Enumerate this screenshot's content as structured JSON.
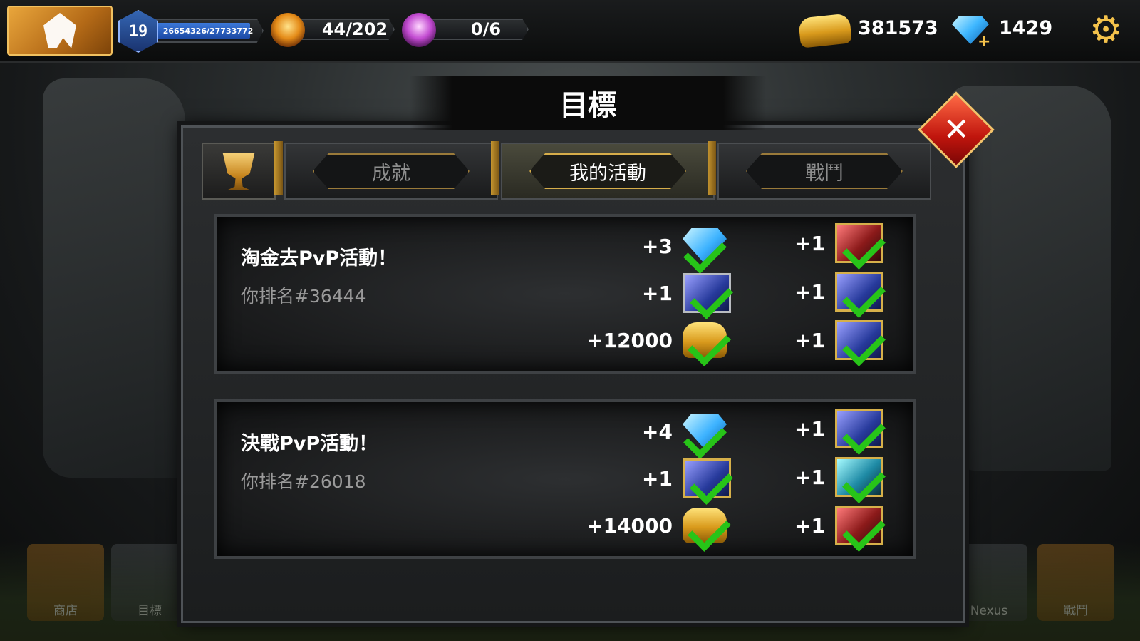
{
  "hud": {
    "level": "19",
    "xp_text": "26654326/27733772",
    "xp_progress": 0.96,
    "stamina": "44/202",
    "potions": "0/6",
    "gold": "381573",
    "gems": "1429"
  },
  "title": "目標",
  "tabs": [
    {
      "label": "成就",
      "active": false
    },
    {
      "label": "我的活動",
      "active": true
    },
    {
      "label": "戰鬥",
      "active": false
    }
  ],
  "events": [
    {
      "title": "淘金去PvP活動！",
      "rank": "你排名#36444",
      "rewards_main": [
        {
          "amount": "+3",
          "icon": "gem-icon"
        },
        {
          "amount": "+1",
          "icon": "hero-card-icon"
        },
        {
          "amount": "+12000",
          "icon": "gold-icon"
        }
      ],
      "rewards_side": [
        {
          "amount": "+1",
          "icon": "hero-card-icon"
        },
        {
          "amount": "+1",
          "icon": "hero-card-icon"
        },
        {
          "amount": "+1",
          "icon": "hero-card-icon"
        }
      ]
    },
    {
      "title": "決戰PvP活動！",
      "rank": "你排名#26018",
      "rewards_main": [
        {
          "amount": "+4",
          "icon": "gem-icon"
        },
        {
          "amount": "+1",
          "icon": "hero-card-icon"
        },
        {
          "amount": "+14000",
          "icon": "gold-icon"
        }
      ],
      "rewards_side": [
        {
          "amount": "+1",
          "icon": "hero-card-icon"
        },
        {
          "amount": "+1",
          "icon": "hero-card-icon"
        },
        {
          "amount": "+1",
          "icon": "hero-card-icon"
        }
      ]
    }
  ],
  "dock": {
    "shop": "商店",
    "goals": "目標",
    "nexus": "Nexus",
    "battle": "戰鬥"
  }
}
